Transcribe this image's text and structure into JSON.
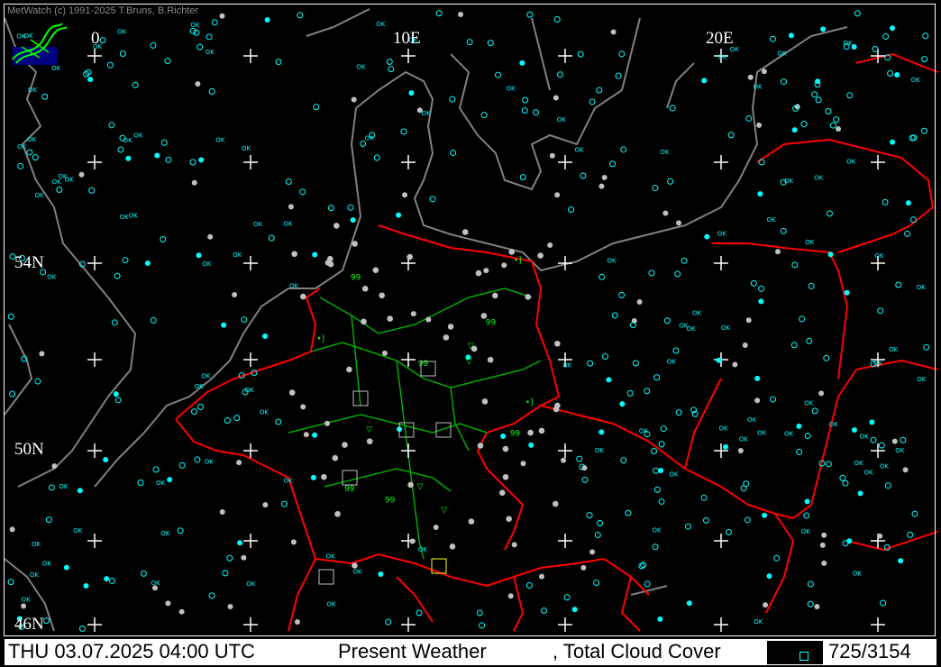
{
  "app": {
    "copyright": "MetWatch  (c) 1991-2025 T.Bruns, B.Richter"
  },
  "map": {
    "longitude_labels": [
      "0",
      "10E",
      "20E"
    ],
    "latitude_labels": [
      "54N",
      "50N",
      "46N"
    ],
    "colors": {
      "background": "#000000",
      "coastline": "#808080",
      "borders": "#ff0000",
      "regions": "#00aa00",
      "grid": "#ffffff",
      "clear_symbol": "#00ffff",
      "cloud_symbol": "#c0c0c0",
      "weather_symbol": "#00ff00"
    },
    "symbols": [
      "rain-shower",
      "drizzle",
      "thunderstorm",
      "fog",
      "clear-ok",
      "overcast"
    ]
  },
  "status_bar": {
    "datetime": "THU 03.07.2025 04:00 UTC",
    "product": "Present Weather",
    "overlay": ", Total Cloud Cover",
    "count": "725/3154"
  }
}
